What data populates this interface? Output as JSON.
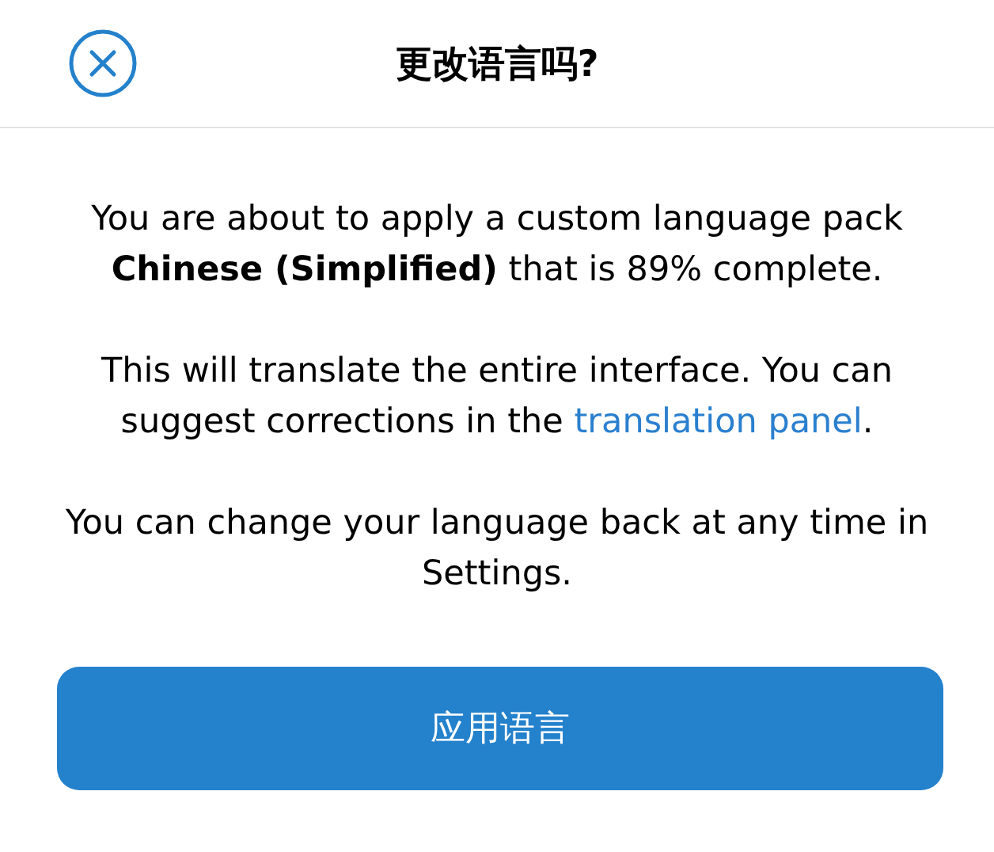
{
  "header": {
    "title": "更改语言吗?"
  },
  "paragraphs": [
    {
      "text": "You are about to apply a custom language pack **Chinese (Simplified)** that is 89% complete."
    },
    {
      "text": "This will translate the entire interface. You can suggest corrections in the ",
      "link": "translation panel",
      "after": "."
    },
    {
      "text": "You can change your language back at any time in Settings."
    }
  ],
  "button": {
    "label": "应用语言"
  }
}
